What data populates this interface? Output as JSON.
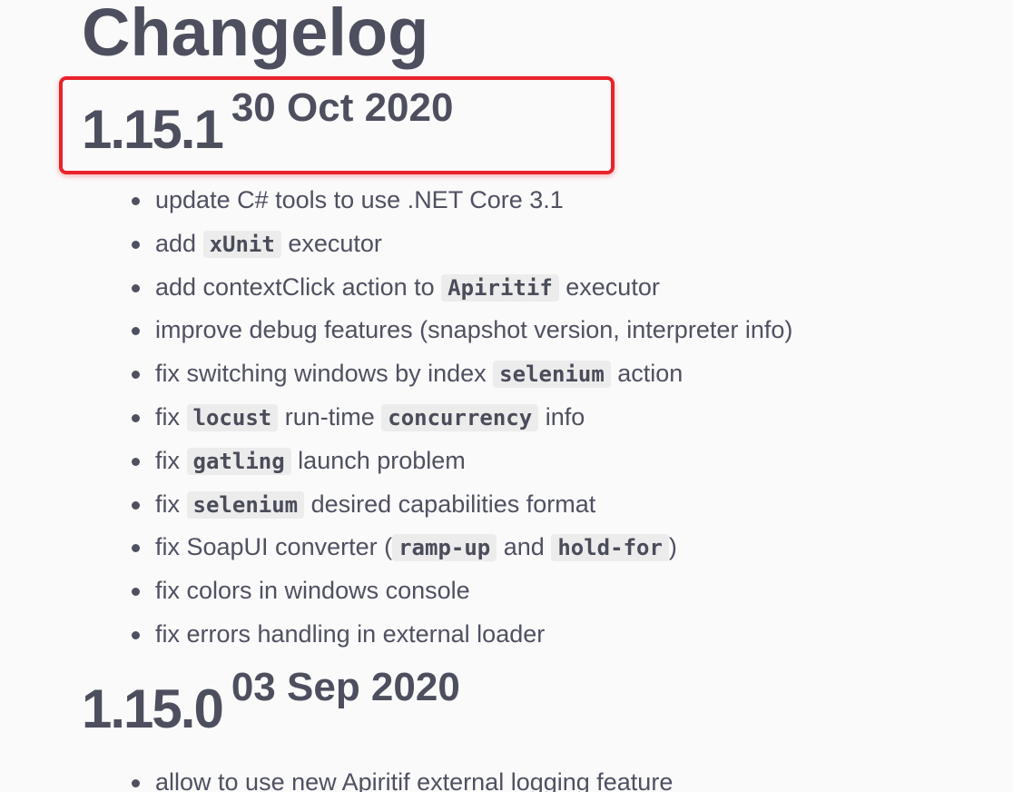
{
  "page": {
    "title": "Changelog"
  },
  "releases": [
    {
      "version": "1.15.1",
      "date": "30 Oct 2020",
      "changes": [
        {
          "text": "update C# tools to use .NET Core 3.1"
        },
        {
          "pre": "add ",
          "code": "xUnit",
          "post": " executor"
        },
        {
          "pre": "add contextClick action to ",
          "code": "Apiritif",
          "post": " executor"
        },
        {
          "text": "improve debug features (snapshot version, interpreter info)"
        },
        {
          "pre": "fix switching windows by index ",
          "code": "selenium",
          "post": " action"
        },
        {
          "pre": "fix ",
          "code": "locust",
          "mid": " run-time ",
          "code2": "concurrency",
          "post": " info"
        },
        {
          "pre": "fix ",
          "code": "gatling",
          "post": " launch problem"
        },
        {
          "pre": "fix ",
          "code": "selenium",
          "post": " desired capabilities format"
        },
        {
          "pre": "fix SoapUI converter (",
          "code": "ramp-up",
          "mid": " and ",
          "code2": "hold-for",
          "post": ")"
        },
        {
          "text": "fix colors in windows console"
        },
        {
          "text": "fix errors handling in external loader"
        }
      ]
    },
    {
      "version": "1.15.0",
      "date": "03 Sep 2020",
      "changes": [
        {
          "text": "allow to use new Apiritif external logging feature"
        }
      ]
    }
  ],
  "highlight": {
    "color": "#e8232b"
  }
}
